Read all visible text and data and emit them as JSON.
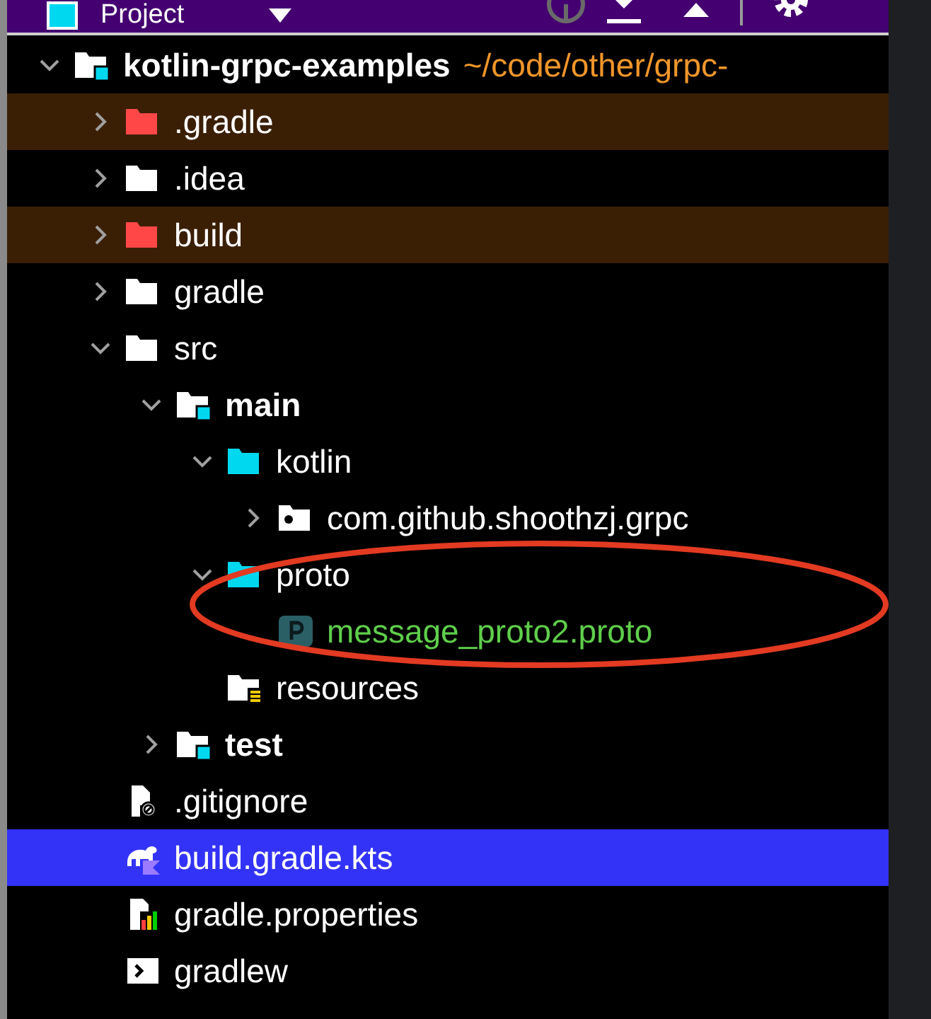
{
  "panel": {
    "title": "Project"
  },
  "tree": [
    {
      "kind": "module",
      "label": "kotlin-grpc-examples",
      "path": "~/code/other/grpc-",
      "expanded": true,
      "excluded": false,
      "selected": false,
      "added": false,
      "children": [
        {
          "kind": "folder",
          "label": ".gradle",
          "expanded": false,
          "excluded": true,
          "selected": false,
          "added": false
        },
        {
          "kind": "folder",
          "label": ".idea",
          "expanded": false,
          "excluded": false,
          "selected": false,
          "added": false
        },
        {
          "kind": "folder",
          "label": "build",
          "expanded": false,
          "excluded": true,
          "selected": false,
          "added": false
        },
        {
          "kind": "folder",
          "label": "gradle",
          "expanded": false,
          "excluded": false,
          "selected": false,
          "added": false
        },
        {
          "kind": "folder",
          "label": "src",
          "expanded": true,
          "excluded": false,
          "selected": false,
          "added": false,
          "children": [
            {
              "kind": "module",
              "label": "main",
              "expanded": true,
              "excluded": false,
              "selected": false,
              "added": false,
              "children": [
                {
                  "kind": "source",
                  "label": "kotlin",
                  "expanded": true,
                  "excluded": false,
                  "selected": false,
                  "added": false,
                  "children": [
                    {
                      "kind": "package",
                      "label": "com.github.shoothzj.grpc",
                      "expanded": false,
                      "excluded": false,
                      "selected": false,
                      "added": false
                    }
                  ]
                },
                {
                  "kind": "source",
                  "label": "proto",
                  "expanded": true,
                  "excluded": false,
                  "selected": false,
                  "added": false,
                  "children": [
                    {
                      "kind": "proto",
                      "label": "message_proto2.proto",
                      "excluded": false,
                      "selected": false,
                      "added": true
                    }
                  ]
                },
                {
                  "kind": "resources",
                  "label": "resources",
                  "excluded": false,
                  "selected": false,
                  "added": false
                }
              ]
            },
            {
              "kind": "module",
              "label": "test",
              "expanded": false,
              "excluded": false,
              "selected": false,
              "added": false
            }
          ]
        },
        {
          "kind": "gitignore",
          "label": ".gitignore",
          "excluded": false,
          "selected": false,
          "added": false
        },
        {
          "kind": "gradle",
          "label": "build.gradle.kts",
          "excluded": false,
          "selected": true,
          "added": false
        },
        {
          "kind": "properties",
          "label": "gradle.properties",
          "excluded": false,
          "selected": false,
          "added": false
        },
        {
          "kind": "shell",
          "label": "gradlew",
          "excluded": false,
          "selected": false,
          "added": false
        }
      ]
    }
  ]
}
